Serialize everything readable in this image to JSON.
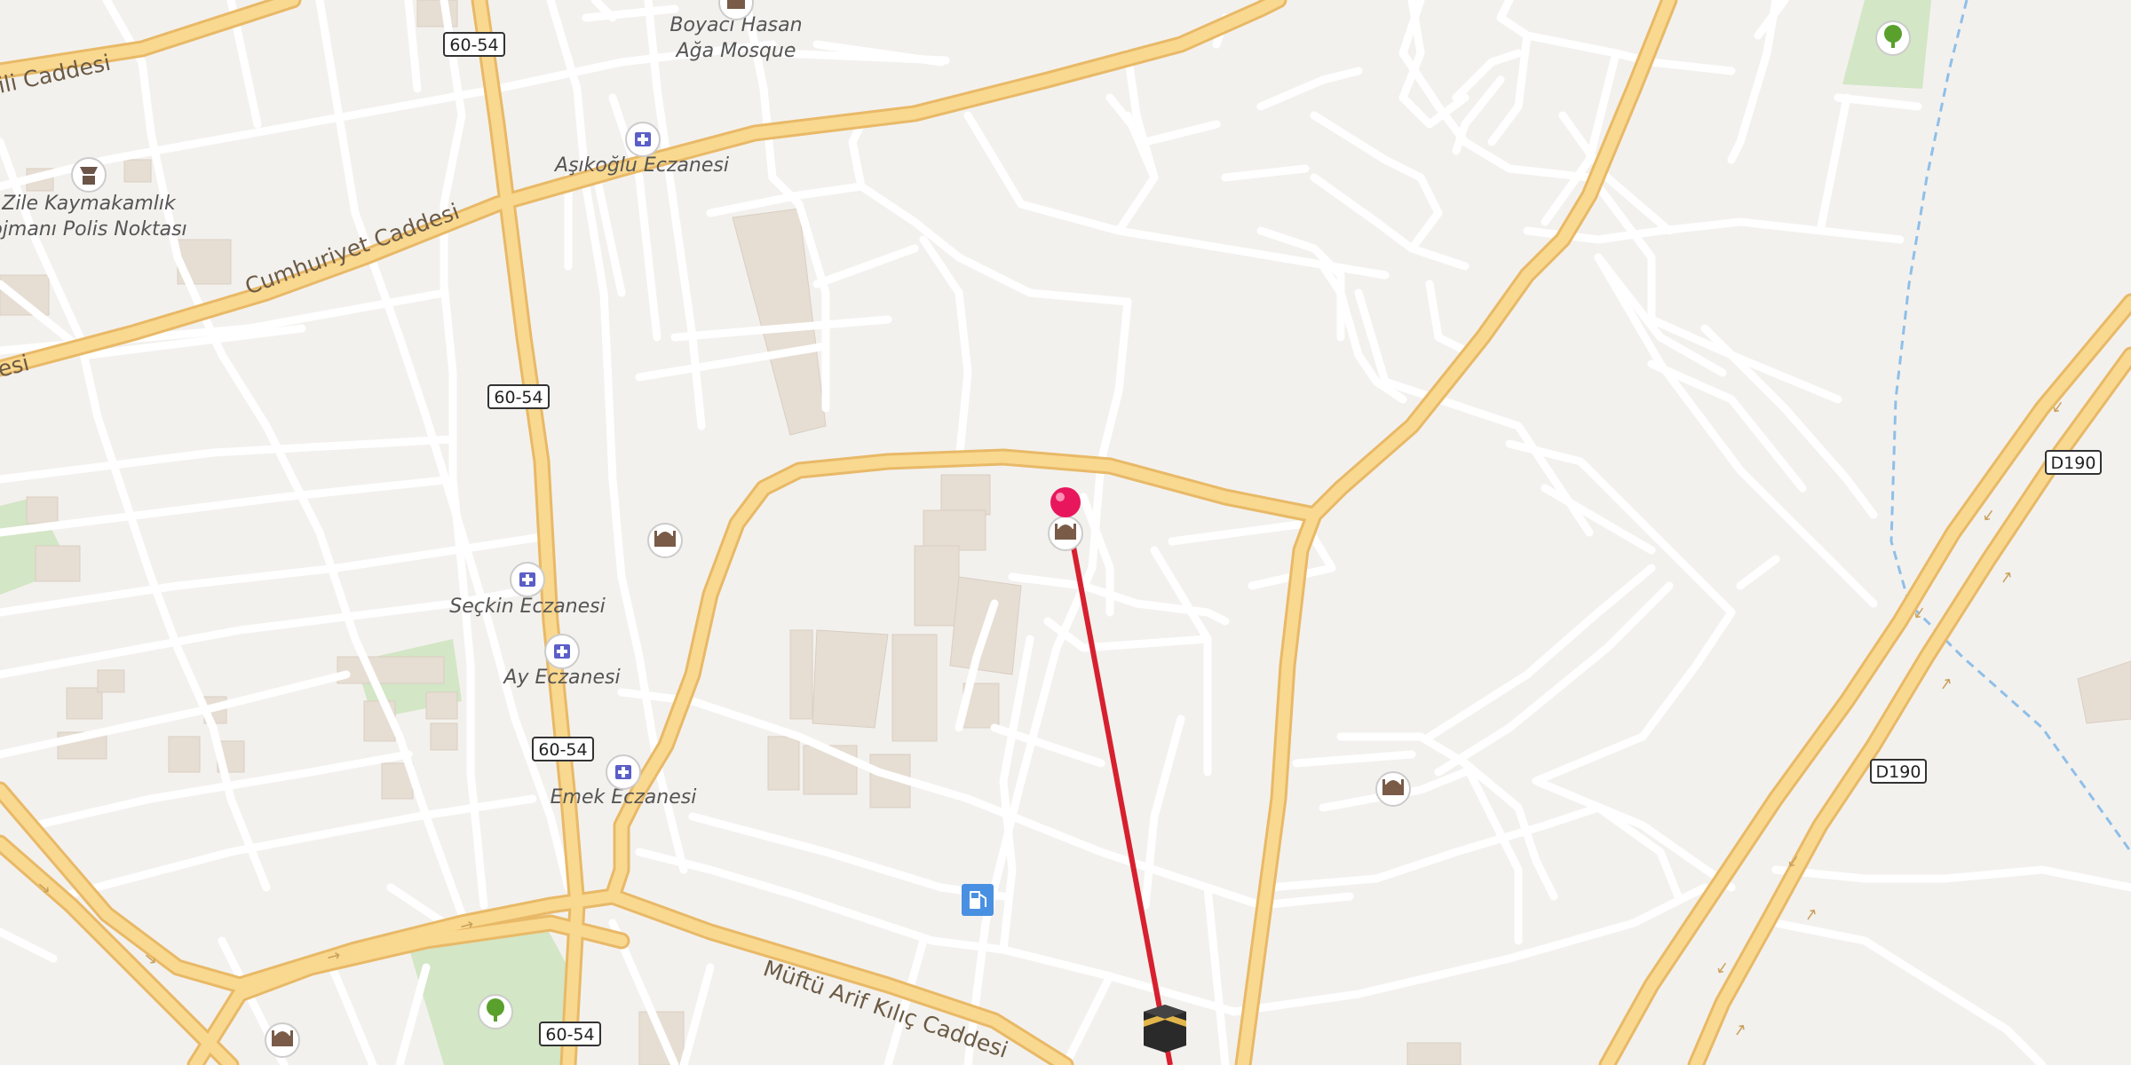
{
  "map": {
    "street_labels": {
      "cumhuriyet": "Cumhuriyet Caddesi",
      "mufti": "Müftü Arif Kılıç Caddesi",
      "top_left": "ili Caddesi",
      "left_edge": "esi"
    },
    "poi_labels": {
      "boyaci_1": "Boyacı Hasan",
      "boyaci_2": "Ağa Mosque",
      "asikoglu": "Aşıkoğlu Eczanesi",
      "zile_1": "Zile Kaymakamlık",
      "zile_2": "ojmanı Polis Noktası",
      "seckin": "Seçkin Eczanesi",
      "ay": "Ay Eczanesi",
      "emek": "Emek Eczanesi"
    },
    "road_shields": {
      "route_60_54": "60-54",
      "route_d190": "D190"
    },
    "icons": [
      "mosque-icon",
      "pharmacy-icon",
      "police-icon",
      "park-icon",
      "fuel-icon",
      "kaaba-icon",
      "location-pin-icon"
    ],
    "colors": {
      "background": "#f3f1ee",
      "minor_road": "#ffffff",
      "major_road": "#f9d88f",
      "major_road_casing": "#e8b967",
      "park": "#d3e6c5",
      "building": "#e6ddd3",
      "qibla_line": "#d7202f",
      "pin": "#e8175d",
      "water_line": "#8fbfe8",
      "pharmacy": "#5b5fc7",
      "fuel": "#4a90e2"
    }
  }
}
